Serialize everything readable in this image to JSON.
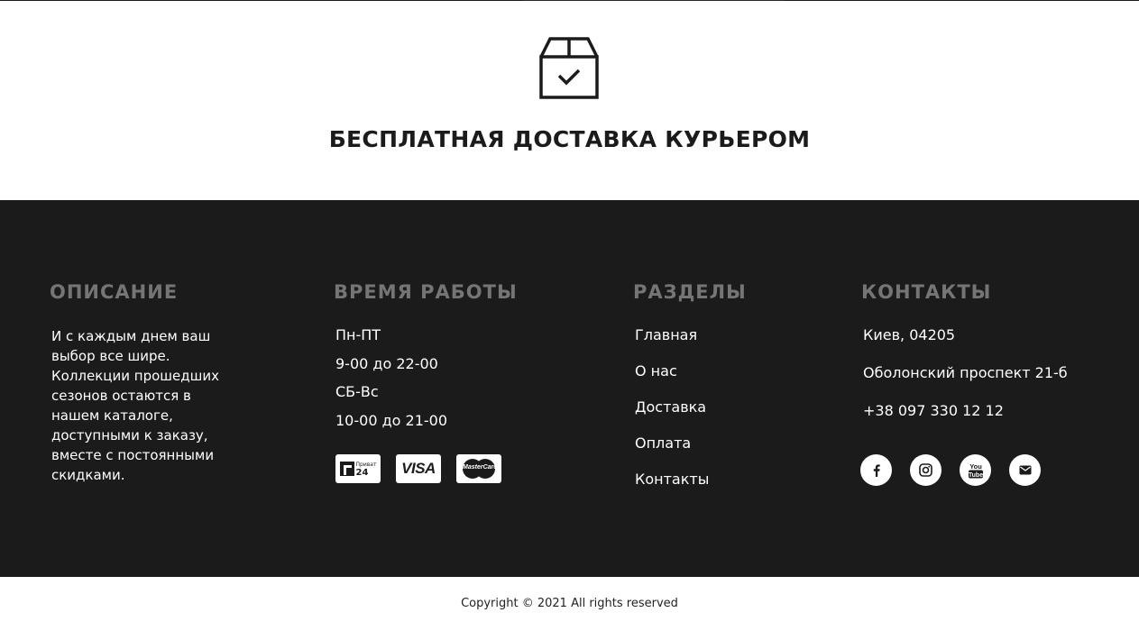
{
  "delivery": {
    "title": "БЕСПЛАТНАЯ ДОСТАВКА КУРЬЕРОМ",
    "icon": "package-check-icon"
  },
  "footer": {
    "description": {
      "heading": "ОПИСАНИЕ",
      "text": "И с каждым днем ваш выбор все шире. Коллекции прошедших сезонов остаются в нашем каталоге, доступными к заказу, вместе с постоянными скидками."
    },
    "hours": {
      "heading": "ВРЕМЯ РАБОТЫ",
      "lines": [
        "Пн-ПТ",
        "9-00 до 22-00",
        "СБ-Вс",
        "10-00 до 21-00"
      ],
      "payments": {
        "privat_small": "Приват",
        "privat_num": "24",
        "visa": "VISA",
        "mastercard": "MasterCard"
      }
    },
    "sections": {
      "heading": "РАЗДЕЛЫ",
      "links": [
        "Главная",
        "О нас",
        "Доставка",
        "Оплата",
        "Контакты"
      ]
    },
    "contacts": {
      "heading": "КОНТАКТЫ",
      "lines": [
        "Киев, 04205",
        "Оболонский проспект 21-б",
        "+38 097 330 12 12"
      ],
      "social": [
        "facebook-icon",
        "instagram-icon",
        "youtube-icon",
        "email-icon"
      ]
    }
  },
  "copyright": "Copyright © 2021 All rights reserved",
  "colors": {
    "footer_bg": "#1c1b1b",
    "heading": "#767575",
    "text": "#ffffff"
  }
}
